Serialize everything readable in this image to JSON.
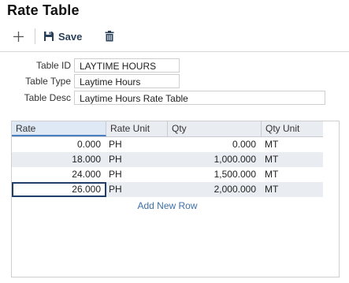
{
  "title": "Rate Table",
  "toolbar": {
    "add_icon": "plus-icon",
    "save_icon": "floppy-disk-icon",
    "save_label": "Save",
    "delete_icon": "trash-icon",
    "accent_color": "#2a3f5a"
  },
  "form": {
    "table_id_label": "Table ID",
    "table_id_value": "LAYTIME HOURS",
    "table_type_label": "Table Type",
    "table_type_value": "Laytime Hours",
    "table_desc_label": "Table Desc",
    "table_desc_value": "Laytime Hours Rate Table"
  },
  "grid": {
    "columns": [
      "Rate",
      "Rate Unit",
      "Qty",
      "Qty Unit"
    ],
    "rows": [
      {
        "rate": "0.000",
        "rate_unit": "PH",
        "qty": "0.000",
        "qty_unit": "MT"
      },
      {
        "rate": "18.000",
        "rate_unit": "PH",
        "qty": "1,000.000",
        "qty_unit": "MT"
      },
      {
        "rate": "24.000",
        "rate_unit": "PH",
        "qty": "1,500.000",
        "qty_unit": "MT"
      },
      {
        "rate": "26.000",
        "rate_unit": "PH",
        "qty": "2,000.000",
        "qty_unit": "MT"
      }
    ],
    "add_row_label": "Add New Row"
  }
}
